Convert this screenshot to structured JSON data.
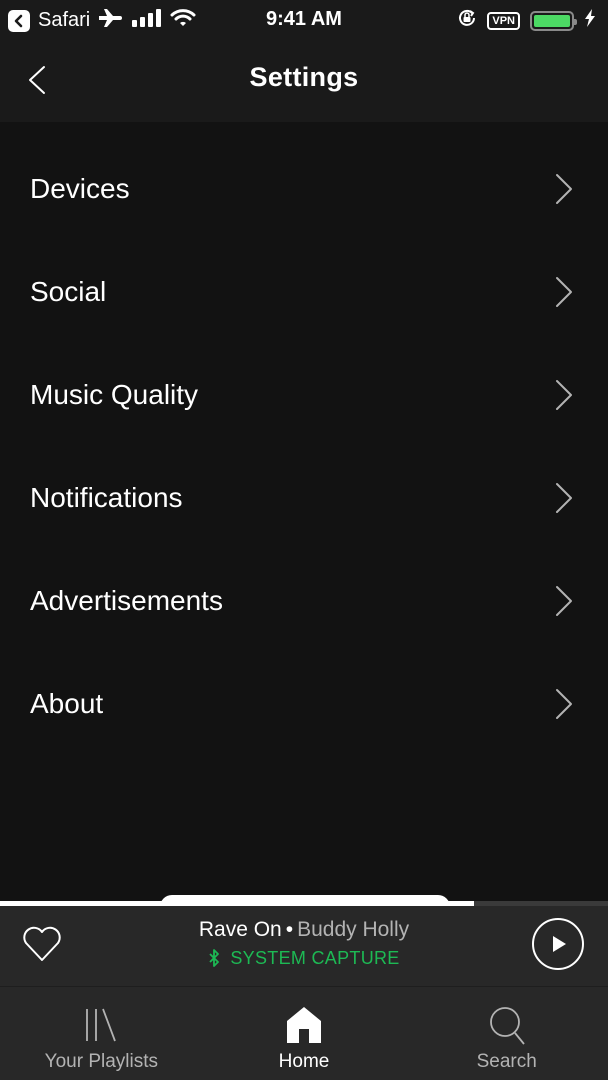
{
  "status_bar": {
    "back_app": "Safari",
    "time": "9:41 AM",
    "vpn_label": "VPN",
    "battery_level": 1.0,
    "icons": [
      "back-to-app-icon",
      "airplane-icon",
      "signal-bars-icon",
      "wifi-icon",
      "orientation-lock-icon",
      "vpn-badge",
      "battery-icon",
      "charging-bolt-icon"
    ]
  },
  "nav": {
    "title": "Settings",
    "back_icon": "chevron-left-icon"
  },
  "menu": {
    "items": [
      {
        "label": "Devices",
        "icon": "chevron-right-icon"
      },
      {
        "label": "Social",
        "icon": "chevron-right-icon"
      },
      {
        "label": "Music Quality",
        "icon": "chevron-right-icon"
      },
      {
        "label": "Notifications",
        "icon": "chevron-right-icon"
      },
      {
        "label": "Advertisements",
        "icon": "chevron-right-icon"
      },
      {
        "label": "About",
        "icon": "chevron-right-icon"
      }
    ]
  },
  "player": {
    "song": "Rave On",
    "separator": "•",
    "artist": "Buddy Holly",
    "device": "SYSTEM CAPTURE",
    "progress": 0.78,
    "accent_color": "#1db954",
    "icons": {
      "like": "heart-icon",
      "device": "bluetooth-icon",
      "play": "play-icon"
    }
  },
  "tabbar": {
    "tabs": [
      {
        "label": "Your Playlists",
        "icon": "library-icon",
        "active": false
      },
      {
        "label": "Home",
        "icon": "home-icon",
        "active": true
      },
      {
        "label": "Search",
        "icon": "search-icon",
        "active": false
      }
    ]
  }
}
